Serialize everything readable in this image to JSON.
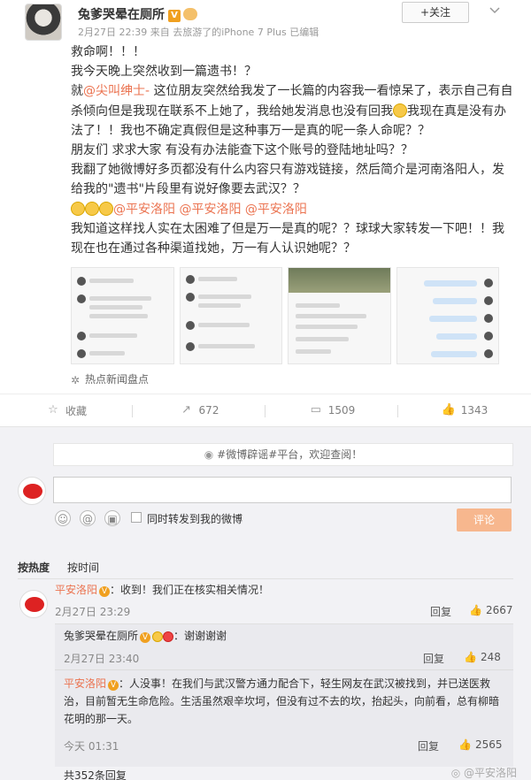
{
  "post": {
    "username": "兔爹哭晕在厕所",
    "verified_badge": "V",
    "time": "2月27日 22:39",
    "source": "来自 去旅游了的iPhone 7 Plus",
    "edited": "已编辑",
    "follow_label": "+关注",
    "paragraphs": [
      "救命啊！！！",
      "我今天晚上突然收到一篇遗书！？",
      "就@尖叫绅士- 这位朋友突然给我发了一长篇的内容我一看惊呆了，表示自己有自杀倾向但是我现在联系不上她了，我给她发消息也没有回我",
      "我现在真是没有办法了！！我也不确定真假但是这种事万一是真的呢一条人命呢？？",
      "朋友们 求求大家 有没有办法能查下这个账号的登陆地址吗？？",
      "我翻了她微博好多页都没有什么内容只有游戏链接，然后简介是河南洛阳人，发给我的\"遗书\"片段里有说好像要去武汉？？",
      "@平安洛阳 @平安洛阳 @平安洛阳",
      "我知道这样找人实在太困难了但是万一是真的呢？？球球大家转发一下吧！！我现在也在通过各种渠道找她，万一有人认识她呢？？"
    ],
    "mention_self": "@尖叫绅士-",
    "mention_police": "@平安洛阳",
    "hot_news": "热点新闻盘点"
  },
  "actions": {
    "favorite": "收藏",
    "repost": "672",
    "comment": "1509",
    "like": "1343"
  },
  "comments_area": {
    "notice": "#微博辟谣#平台，欢迎查阅！",
    "input_placeholder": "",
    "repost_label": "同时转发到我的微博",
    "submit_label": "评论",
    "sort_hot": "按热度",
    "sort_time": "按时间",
    "items": [
      {
        "name": "平安洛阳",
        "text": "：收到！我们正在核实相关情况！",
        "time": "2月27日 23:29",
        "reply": "回复",
        "likes": "2667"
      }
    ],
    "nested": [
      {
        "name": "兔爹哭晕在厕所",
        "text": "：谢谢谢谢",
        "time": "2月27日 23:40",
        "reply": "回复",
        "likes": "248"
      },
      {
        "name": "平安洛阳",
        "text": "：人没事！在我们与武汉警方通力配合下，轻生网友在武汉被找到，并已送医救治，目前暂无生命危险。生活虽然艰辛坎坷，但没有过不去的坎，抬起头，向前看，总有柳暗花明的那一天。",
        "time": "今天 01:31",
        "reply": "回复",
        "likes": "2565"
      }
    ],
    "total": "共352条回复",
    "watermark": "@平安洛阳"
  }
}
